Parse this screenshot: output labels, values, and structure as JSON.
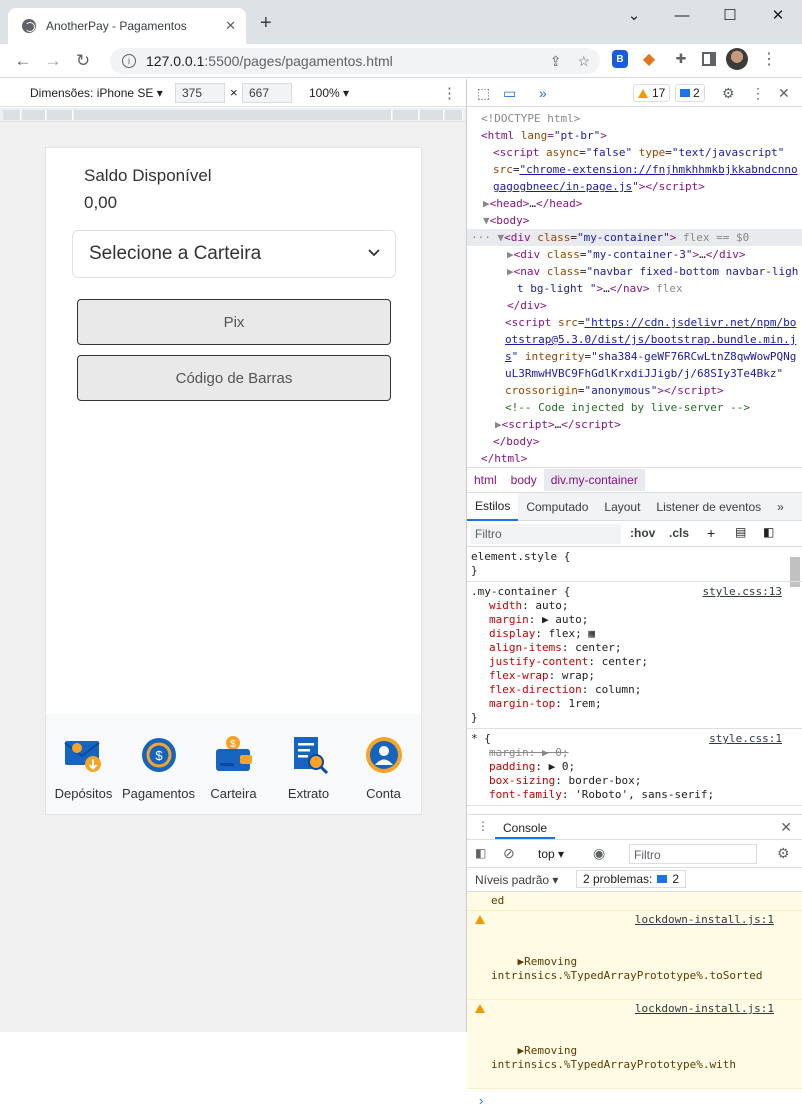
{
  "browser": {
    "tab_title": "AnotherPay - Pagamentos",
    "url_host": "127.0.0.1",
    "url_rest": ":5500/pages/pagamentos.html"
  },
  "device_toolbar": {
    "dimensions_label": "Dimensões: iPhone SE ▾",
    "width": "375",
    "height": "667",
    "times": "×",
    "zoom": "100% ▾"
  },
  "app": {
    "saldo_label": "Saldo Disponível",
    "saldo_value": "0,00",
    "wallet_select": "Selecione a Carteira",
    "btn_pix": "Pix",
    "btn_barcode": "Código de Barras",
    "nav": [
      {
        "label": "Depósitos"
      },
      {
        "label": "Pagamentos"
      },
      {
        "label": "Carteira"
      },
      {
        "label": "Extrato"
      },
      {
        "label": "Conta"
      }
    ]
  },
  "devtools": {
    "warn_count": "17",
    "msg_count": "2",
    "crumbs": [
      "html",
      "body",
      "div.my-container"
    ],
    "panel_tabs": [
      "Estilos",
      "Computado",
      "Layout",
      "Listener de eventos"
    ],
    "filter_placeholder": "Filtro",
    "hov": ":hov",
    "cls": ".cls",
    "console_title": "Console",
    "console_context": "top ▾",
    "console_filter": "Filtro",
    "levels": "Níveis padrão ▾",
    "problems": "2 problemas:",
    "problems_count": "2",
    "messages": [
      {
        "text": "ed",
        "source": ""
      },
      {
        "text": "▶Removing\nintrinsics.%TypedArrayPrototype%.toSorted",
        "source": "lockdown-install.js:1"
      },
      {
        "text": "▶Removing\nintrinsics.%TypedArrayPrototype%.with",
        "source": "lockdown-install.js:1"
      }
    ],
    "style_src_1": "style.css:13",
    "style_src_2": "style.css:1"
  },
  "colors": {
    "icon_blue": "#1565c0",
    "icon_orange": "#f7a325"
  }
}
